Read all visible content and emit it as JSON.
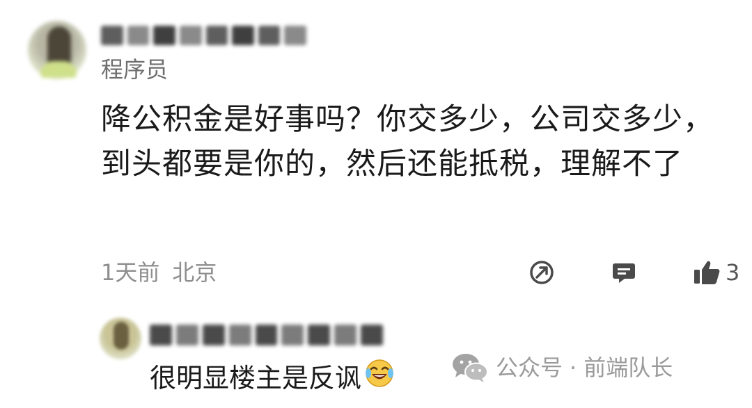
{
  "comment": {
    "role": "程序员",
    "text": "降公积金是好事吗？你交多少，公司交多少，到头都要是你的，然后还能抵税，理解不了",
    "time": "1天前",
    "location": "北京",
    "like_count": "3"
  },
  "reply": {
    "text": "很明显楼主是反讽"
  },
  "watermark": {
    "source": "公众号",
    "separator": "·",
    "account": "前端队长"
  },
  "colors": {
    "text": "#1a1a1a",
    "meta": "#8e8e8e",
    "icon": "#4a4a4a",
    "watermark": "#9a9a9a"
  },
  "icons": {
    "share": "share-arrow-icon",
    "comment": "comment-bubble-icon",
    "like": "thumbs-up-icon",
    "wechat": "wechat-logo-icon",
    "emoji": "laughing-tears-emoji-icon"
  }
}
